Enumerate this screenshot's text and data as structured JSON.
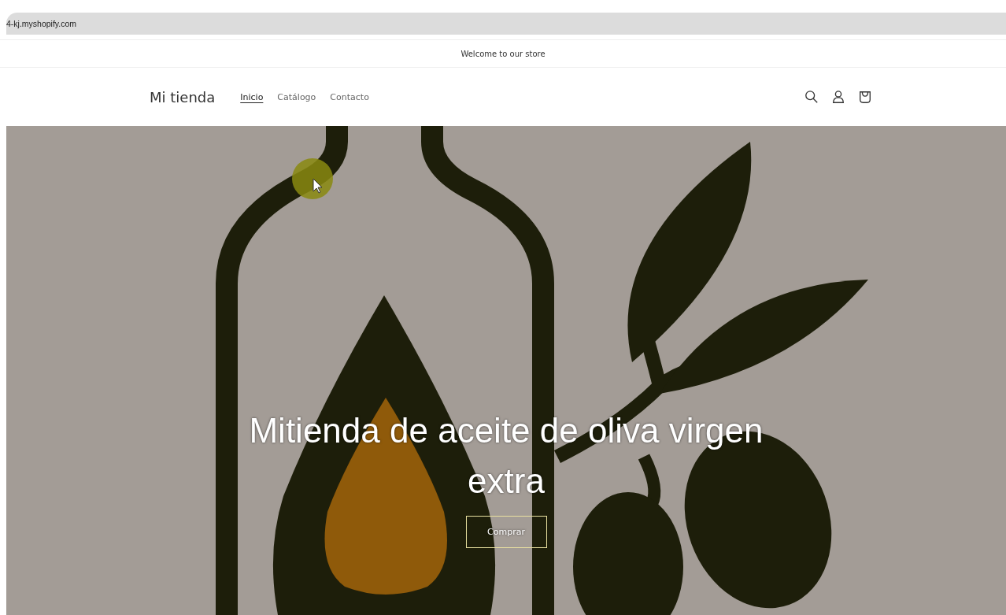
{
  "address_bar": {
    "url": "4-kj.myshopify.com"
  },
  "announcement": "Welcome to our store",
  "header": {
    "logo": "Mi tienda",
    "nav": [
      {
        "label": "Inicio",
        "selected": true
      },
      {
        "label": "Catálogo",
        "selected": false
      },
      {
        "label": "Contacto",
        "selected": false
      }
    ]
  },
  "hero": {
    "heading": "Mitienda de aceite de oliva virgen extra",
    "button": "Comprar"
  }
}
